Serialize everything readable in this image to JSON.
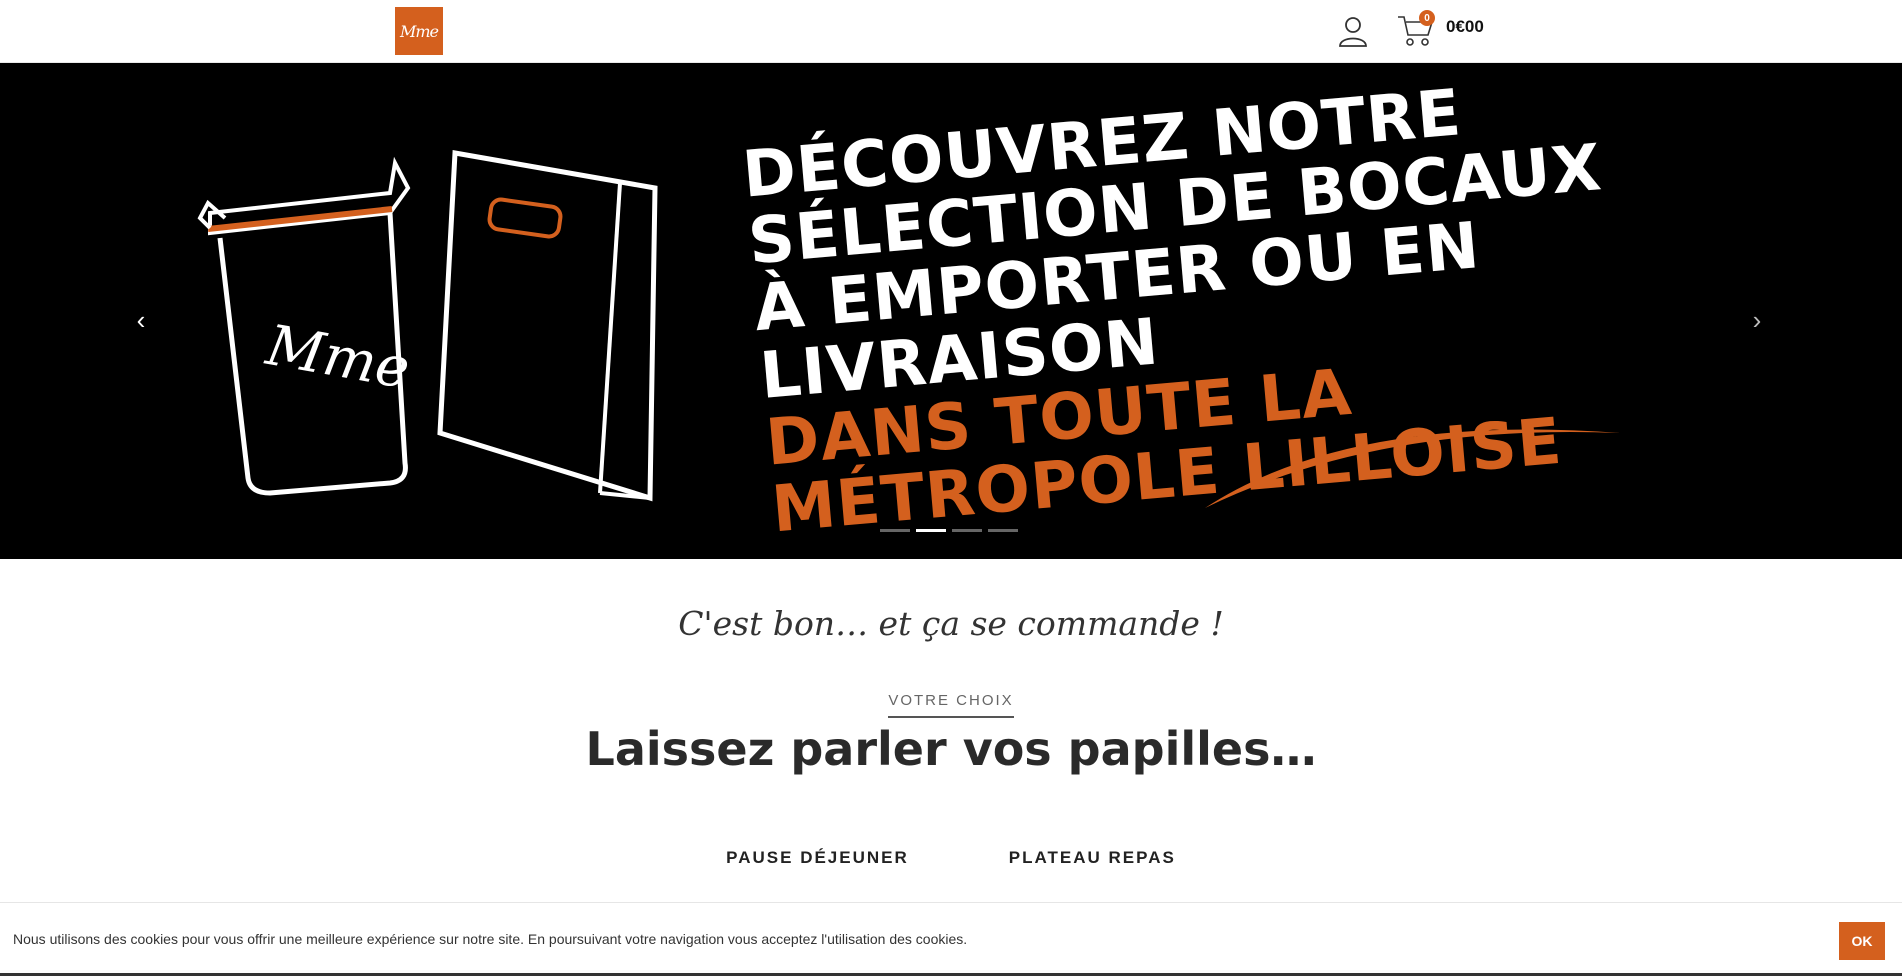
{
  "header": {
    "logo_text": "Mme",
    "cart_count": "0",
    "cart_total": "0€00",
    "icons": [
      "user-icon",
      "cart-icon"
    ]
  },
  "slider": {
    "line1": "Découvrez notre sélection de bocaux",
    "line2": "à emporter ou en livraison",
    "line3": "dans toute la métropole lilloise",
    "jar_lettering": "Mme",
    "prev": "‹",
    "next": "›",
    "active_slide": 2,
    "slide_count": 4
  },
  "content": {
    "tagline": "C'est bon… et ça se commande !",
    "kicker": "VOTRE CHOIX",
    "title": "Laissez parler vos papilles…",
    "tabs": [
      "PAUSE DÉJEUNER",
      "PLATEAU REPAS"
    ]
  },
  "cookie": {
    "text": "Nous utilisons des cookies pour vous offrir une meilleure expérience sur notre site. En poursuivant votre navigation vous acceptez l'utilisation des cookies.",
    "ok": "OK"
  },
  "colors": {
    "accent": "#d4601e",
    "slider_bg": "#000000"
  }
}
